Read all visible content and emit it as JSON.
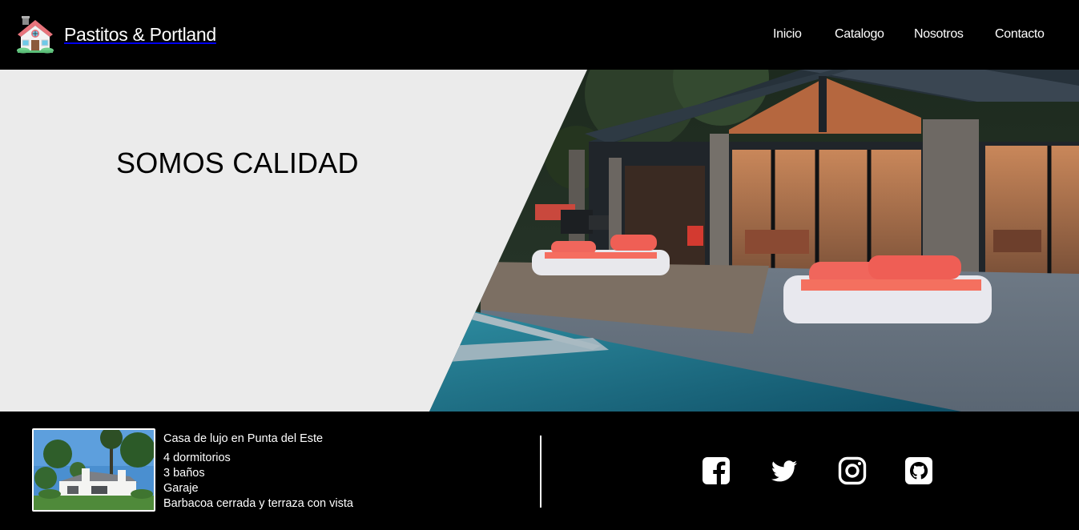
{
  "header": {
    "brand_name": "Pastitos & Portland",
    "logo_icon": "house-icon",
    "nav": {
      "inicio": "Inicio",
      "catalogo": "Catalogo",
      "nosotros": "Nosotros",
      "contacto": "Contacto"
    }
  },
  "hero": {
    "title": "SOMOS CALIDAD",
    "panel_color": "#ebebeb"
  },
  "footer": {
    "property": {
      "title": "Casa de lujo en Punta del Este",
      "features": [
        "4 dormitorios",
        "3 baños",
        "Garaje",
        "Barbacoa cerrada y terraza con vista"
      ]
    },
    "social": [
      "facebook-icon",
      "twitter-icon",
      "instagram-icon",
      "github-icon"
    ]
  }
}
